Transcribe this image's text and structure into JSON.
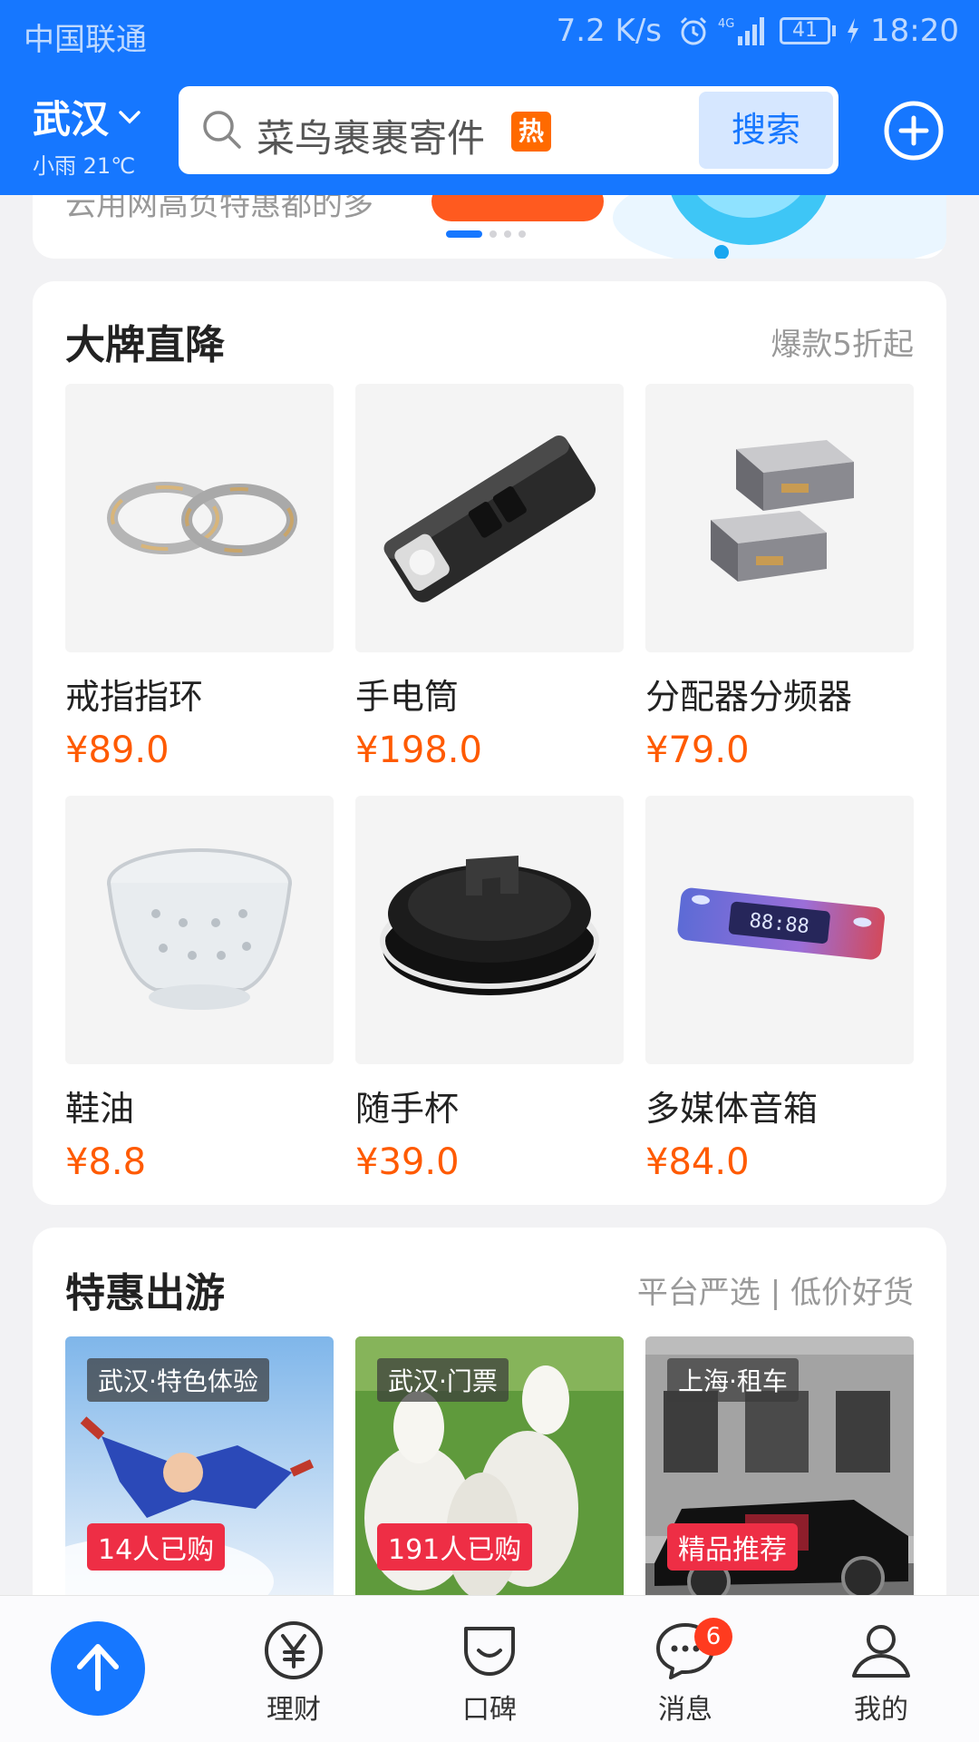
{
  "status_bar": {
    "carrier": "中国联通",
    "net_speed": "7.2 K/s",
    "signal_label": "4G",
    "battery": "41",
    "time": "18:20"
  },
  "header": {
    "city": "武汉",
    "weather": "小雨 21℃",
    "search_placeholder": "菜鸟裹裹寄件",
    "hot_badge": "热",
    "search_button": "搜索",
    "add_icon": "plus-circle-icon"
  },
  "banner": {
    "text": "云用网高负特惠都的多"
  },
  "brand_section": {
    "title": "大牌直降",
    "subtitle": "爆款5折起",
    "products": [
      {
        "name": "戒指指环",
        "price": "¥89.0",
        "icon": "ring-pair"
      },
      {
        "name": "手电筒",
        "price": "¥198.0",
        "icon": "flashlight"
      },
      {
        "name": "分配器分频器",
        "price": "¥79.0",
        "icon": "splitter"
      },
      {
        "name": "鞋油",
        "price": "¥8.8",
        "icon": "strainer"
      },
      {
        "name": "随手杯",
        "price": "¥39.0",
        "icon": "cup-lid"
      },
      {
        "name": "多媒体音箱",
        "price": "¥84.0",
        "icon": "speaker"
      }
    ]
  },
  "travel_section": {
    "title": "特惠出游",
    "subtitle": "平台严选 | 低价好货",
    "items": [
      {
        "tag": "武汉·特色体验",
        "badge": "14人已购"
      },
      {
        "tag": "武汉·门票",
        "badge": "191人已购"
      },
      {
        "tag": "上海·租车",
        "badge": "精品推荐"
      }
    ]
  },
  "bottom_nav": {
    "items": [
      {
        "label": "理财",
        "icon": "yen-icon"
      },
      {
        "label": "口碑",
        "icon": "koubei-icon"
      },
      {
        "label": "消息",
        "icon": "message-icon",
        "badge": "6"
      },
      {
        "label": "我的",
        "icon": "user-icon"
      }
    ]
  },
  "colors": {
    "brand_blue": "#1677ff",
    "price_orange": "#ff5a00",
    "badge_red": "#ee2e45"
  }
}
